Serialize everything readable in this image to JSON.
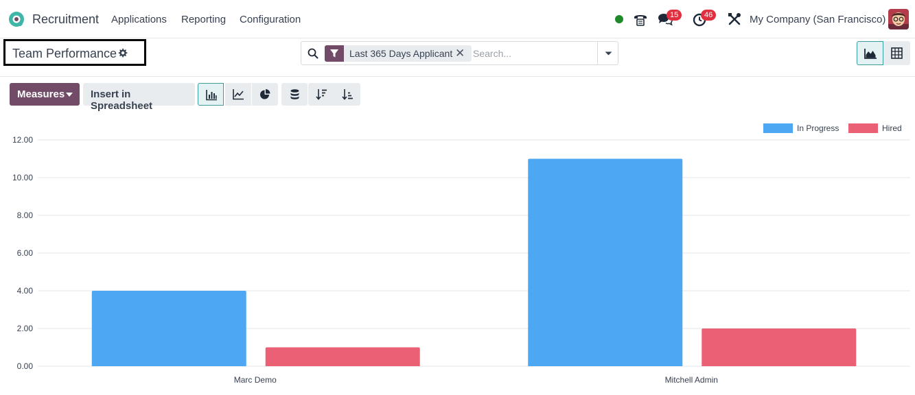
{
  "navbar": {
    "app_name": "Recruitment",
    "menus": [
      "Applications",
      "Reporting",
      "Configuration"
    ],
    "messages_count": "15",
    "activities_count": "46",
    "company": "My Company (San Francisco)"
  },
  "control_panel": {
    "title": "Team Performance",
    "search": {
      "facet": "Last 365 Days Applicant",
      "placeholder": "Search..."
    }
  },
  "toolbar": {
    "measures_label": "Measures",
    "insert_label": "Insert in Spreadsheet"
  },
  "colors": {
    "brand": "#714b67",
    "accent": "#3a9c9d",
    "in_progress": "#4ea7f2",
    "hired": "#ea6175"
  },
  "icons": [
    "app-logo-icon",
    "phone-icon",
    "chat-icon",
    "clock-icon",
    "tools-icon",
    "gear-icon",
    "search-icon",
    "filter-icon",
    "close-icon",
    "caret-down-icon",
    "graph-view-icon",
    "pivot-view-icon",
    "bar-chart-icon",
    "line-chart-icon",
    "pie-chart-icon",
    "stacked-icon",
    "sort-descending-icon",
    "sort-ascending-icon"
  ],
  "chart_data": {
    "type": "bar",
    "categories": [
      "Marc Demo",
      "Mitchell Admin"
    ],
    "series": [
      {
        "name": "In Progress",
        "values": [
          4,
          11
        ],
        "color": "#4ea7f2"
      },
      {
        "name": "Hired",
        "values": [
          1,
          2
        ],
        "color": "#ea6175"
      }
    ],
    "yticks": [
      "0.00",
      "2.00",
      "4.00",
      "6.00",
      "8.00",
      "10.00",
      "12.00"
    ],
    "ylim": [
      0,
      12
    ],
    "grid": true,
    "legend": "top-right"
  }
}
